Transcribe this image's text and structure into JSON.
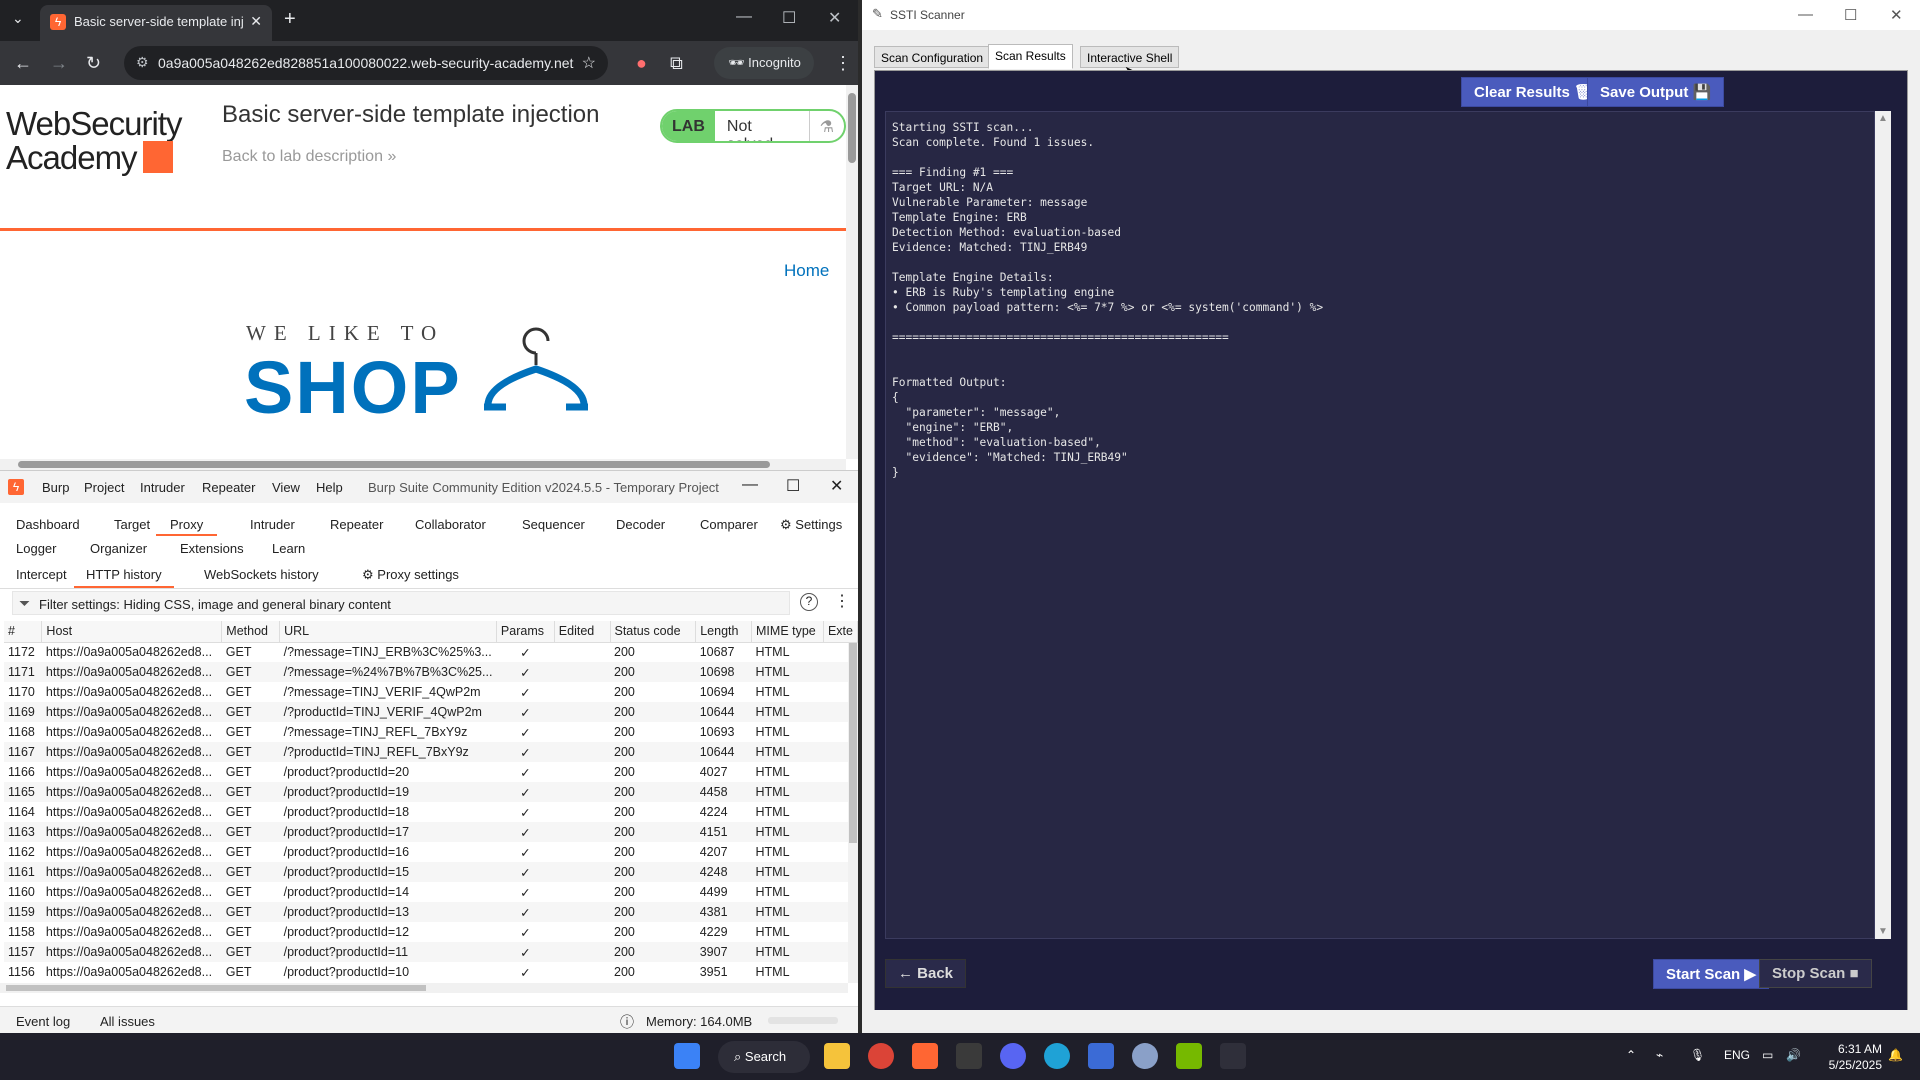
{
  "chrome": {
    "tab_title": "Basic server-side template inje",
    "url": "0a9a005a048262ed828851a100080022.web-security-academy.net",
    "incognito_label": "Incognito",
    "logo_line1": "WebSecurity",
    "logo_line2": "Academy",
    "lab_title": "Basic server-side template injection",
    "back_link": "Back to lab description",
    "lab_badge": "LAB",
    "lab_status": "Not solved",
    "home_link": "Home",
    "shop_small": "WE LIKE TO",
    "shop_big": "SHOP"
  },
  "burp": {
    "menu": [
      "Burp",
      "Project",
      "Intruder",
      "Repeater",
      "View",
      "Help"
    ],
    "window_title": "Burp Suite Community Edition v2024.5.5 - Temporary Project",
    "tabs_row1": [
      "Dashboard",
      "Target",
      "Proxy",
      "Intruder",
      "Repeater",
      "Collaborator",
      "Sequencer",
      "Decoder",
      "Comparer",
      "Settings"
    ],
    "tabs_row2": [
      "Logger",
      "Organizer",
      "Extensions",
      "Learn"
    ],
    "subtabs": [
      "Intercept",
      "HTTP history",
      "WebSockets history",
      "Proxy settings"
    ],
    "filter_text": "Filter settings: Hiding CSS, image and general binary content",
    "columns": [
      "#",
      "Host",
      "Method",
      "URL",
      "Params",
      "Edited",
      "Status code",
      "Length",
      "MIME type",
      "Exte"
    ],
    "rows": [
      [
        "1172",
        "https://0a9a005a048262ed8...",
        "GET",
        "/?message=TINJ_ERB%3C%25%3...",
        "✓",
        "",
        "200",
        "10687",
        "HTML"
      ],
      [
        "1171",
        "https://0a9a005a048262ed8...",
        "GET",
        "/?message=%24%7B%7B%3C%25...",
        "✓",
        "",
        "200",
        "10698",
        "HTML"
      ],
      [
        "1170",
        "https://0a9a005a048262ed8...",
        "GET",
        "/?message=TINJ_VERIF_4QwP2m",
        "✓",
        "",
        "200",
        "10694",
        "HTML"
      ],
      [
        "1169",
        "https://0a9a005a048262ed8...",
        "GET",
        "/?productId=TINJ_VERIF_4QwP2m",
        "✓",
        "",
        "200",
        "10644",
        "HTML"
      ],
      [
        "1168",
        "https://0a9a005a048262ed8...",
        "GET",
        "/?message=TINJ_REFL_7BxY9z",
        "✓",
        "",
        "200",
        "10693",
        "HTML"
      ],
      [
        "1167",
        "https://0a9a005a048262ed8...",
        "GET",
        "/?productId=TINJ_REFL_7BxY9z",
        "✓",
        "",
        "200",
        "10644",
        "HTML"
      ],
      [
        "1166",
        "https://0a9a005a048262ed8...",
        "GET",
        "/product?productId=20",
        "✓",
        "",
        "200",
        "4027",
        "HTML"
      ],
      [
        "1165",
        "https://0a9a005a048262ed8...",
        "GET",
        "/product?productId=19",
        "✓",
        "",
        "200",
        "4458",
        "HTML"
      ],
      [
        "1164",
        "https://0a9a005a048262ed8...",
        "GET",
        "/product?productId=18",
        "✓",
        "",
        "200",
        "4224",
        "HTML"
      ],
      [
        "1163",
        "https://0a9a005a048262ed8...",
        "GET",
        "/product?productId=17",
        "✓",
        "",
        "200",
        "4151",
        "HTML"
      ],
      [
        "1162",
        "https://0a9a005a048262ed8...",
        "GET",
        "/product?productId=16",
        "✓",
        "",
        "200",
        "4207",
        "HTML"
      ],
      [
        "1161",
        "https://0a9a005a048262ed8...",
        "GET",
        "/product?productId=15",
        "✓",
        "",
        "200",
        "4248",
        "HTML"
      ],
      [
        "1160",
        "https://0a9a005a048262ed8...",
        "GET",
        "/product?productId=14",
        "✓",
        "",
        "200",
        "4499",
        "HTML"
      ],
      [
        "1159",
        "https://0a9a005a048262ed8...",
        "GET",
        "/product?productId=13",
        "✓",
        "",
        "200",
        "4381",
        "HTML"
      ],
      [
        "1158",
        "https://0a9a005a048262ed8...",
        "GET",
        "/product?productId=12",
        "✓",
        "",
        "200",
        "4229",
        "HTML"
      ],
      [
        "1157",
        "https://0a9a005a048262ed8...",
        "GET",
        "/product?productId=11",
        "✓",
        "",
        "200",
        "3907",
        "HTML"
      ],
      [
        "1156",
        "https://0a9a005a048262ed8...",
        "GET",
        "/product?productId=10",
        "✓",
        "",
        "200",
        "3951",
        "HTML"
      ]
    ],
    "event_log": "Event log",
    "all_issues": "All issues",
    "memory": "Memory: 164.0MB"
  },
  "ssti": {
    "window_title": "SSTI Scanner",
    "tabs": [
      "Scan Configuration",
      "Scan Results",
      "Interactive Shell"
    ],
    "clear_results": "Clear Results",
    "save_output": "Save Output",
    "output": "Starting SSTI scan...\nScan complete. Found 1 issues.\n\n=== Finding #1 ===\nTarget URL: N/A\nVulnerable Parameter: message\nTemplate Engine: ERB\nDetection Method: evaluation-based\nEvidence: Matched: TINJ_ERB49\n\nTemplate Engine Details:\n• ERB is Ruby's templating engine\n• Common payload pattern: <%= 7*7 %> or <%= system('command') %>\n\n==================================================\n\n\nFormatted Output:\n{\n  \"parameter\": \"message\",\n  \"engine\": \"ERB\",\n  \"method\": \"evaluation-based\",\n  \"evidence\": \"Matched: TINJ_ERB49\"\n}",
    "back_button": "← Back",
    "start_scan": "Start Scan",
    "stop_scan": "Stop Scan"
  },
  "taskbar": {
    "search_label": "Search",
    "lang": "ENG",
    "time": "6:31 AM",
    "date": "5/25/2025"
  }
}
